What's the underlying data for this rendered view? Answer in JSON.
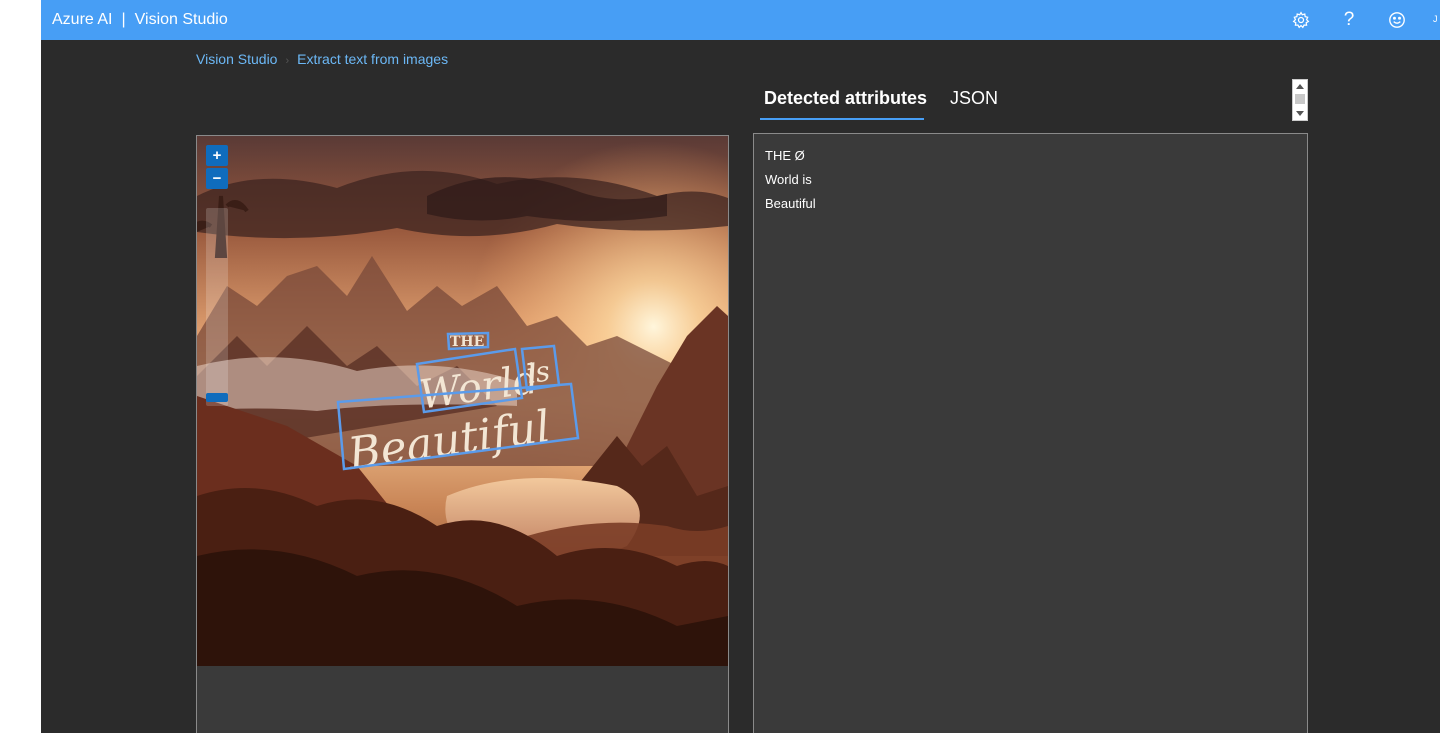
{
  "header": {
    "product": "Azure AI",
    "separator": "|",
    "app_title": "Vision Studio",
    "avatar_initial": "J",
    "icons": [
      "settings-icon",
      "help-icon",
      "feedback-icon"
    ]
  },
  "breadcrumb": {
    "root": "Vision Studio",
    "separator": "›",
    "current": "Extract text from images"
  },
  "viewer": {
    "zoom_in_label": "+",
    "zoom_out_label": "−",
    "zoom_level": 0.02,
    "image_text_lines": [
      "THE",
      "World",
      "is",
      "Beautiful"
    ]
  },
  "tabs": [
    {
      "label": "Detected attributes",
      "active": true
    },
    {
      "label": "JSON",
      "active": false
    }
  ],
  "results": {
    "lines": [
      "THE Ø",
      "World is",
      "Beautiful"
    ]
  },
  "colors": {
    "accent": "#479ef5",
    "background": "#2b2b2b",
    "panel": "#3a3a3a",
    "bounding_box": "#5b9bea",
    "link": "#6cb8f6"
  }
}
